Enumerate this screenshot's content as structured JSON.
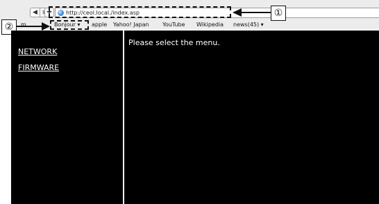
{
  "toolbar": {
    "back_glyph": "◀",
    "forward_glyph": "▶",
    "add_glyph": "✚",
    "address_value": "http://ceol.local./index.asp"
  },
  "bookmarks": {
    "partial": "m",
    "items": [
      "Bonjour ▾",
      "apple",
      "Yahoo! Japan",
      "YouTube",
      "Wikipedia",
      "news(45) ▾"
    ]
  },
  "callouts": {
    "one": "①",
    "two": "②"
  },
  "page": {
    "nav": [
      "NETWORK",
      "FIRMWARE"
    ],
    "message": "Please select the menu."
  },
  "colors": {
    "page_bg": "#000000",
    "chrome_bg": "#ececec",
    "text_on_dark": "#ffffff"
  }
}
